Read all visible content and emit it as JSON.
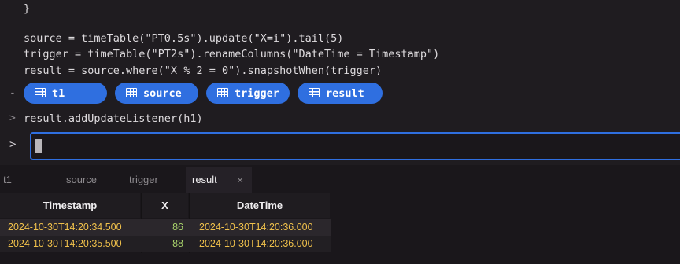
{
  "console": {
    "lines": [
      "}",
      "source = timeTable(\"PT0.5s\").update(\"X=i\").tail(5)",
      "trigger = timeTable(\"PT2s\").renameColumns(\"DateTime = Timestamp\")",
      "result = source.where(\"X % 2 = 0\").snapshotWhen(trigger)",
      "result.addUpdateListener(h1)"
    ],
    "gutter_dash": "-",
    "gutter_prompt": ">",
    "input_prompt": ">",
    "chips": [
      {
        "label": "t1"
      },
      {
        "label": "source"
      },
      {
        "label": "trigger"
      },
      {
        "label": "result"
      }
    ]
  },
  "tabs": [
    {
      "label": "t1"
    },
    {
      "label": "source"
    },
    {
      "label": "trigger"
    },
    {
      "label": "result"
    }
  ],
  "active_tab": "result",
  "close_glyph": "×",
  "table": {
    "columns": [
      "Timestamp",
      "X",
      "DateTime"
    ],
    "rows": [
      {
        "Timestamp": "2024-10-30T14:20:34.500",
        "X": "86",
        "DateTime": "2024-10-30T14:20:36.000"
      },
      {
        "Timestamp": "2024-10-30T14:20:35.500",
        "X": "88",
        "DateTime": "2024-10-30T14:20:36.000"
      }
    ]
  },
  "colors": {
    "accent": "#2f6fe0",
    "timestamp": "#f0c14b",
    "number": "#a7d16b"
  }
}
